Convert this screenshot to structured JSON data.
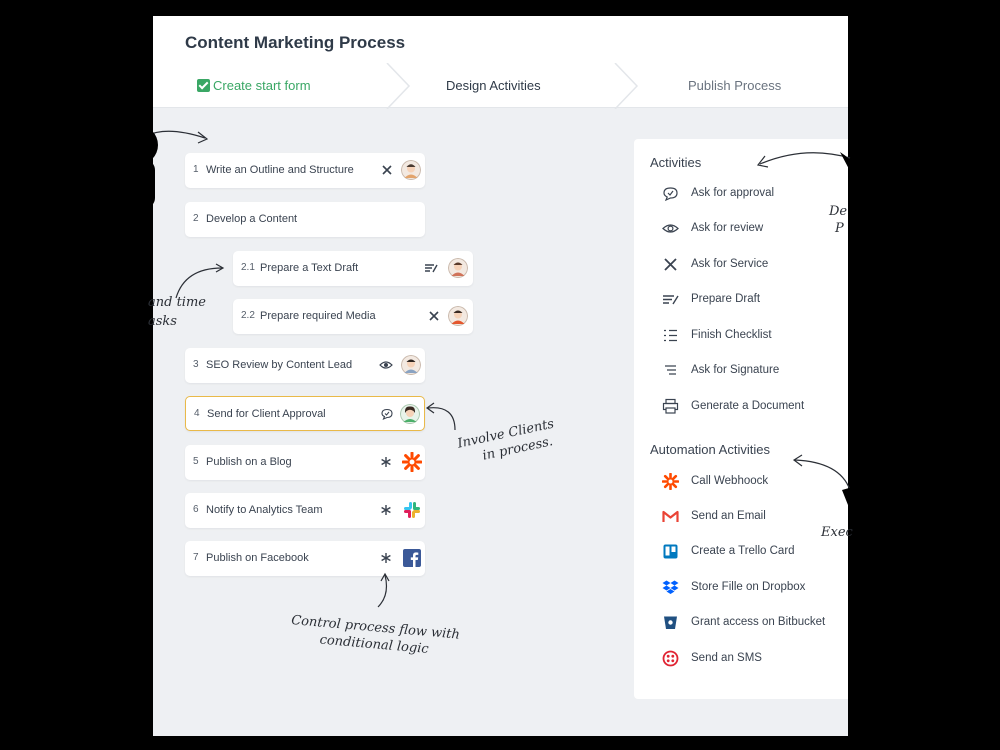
{
  "window": {
    "title": "Content Marketing Process",
    "steps": [
      "Create start form",
      "Design Activities",
      "Publish Process"
    ]
  },
  "tasks": [
    {
      "num": "1",
      "label": "Write an Outline and Structure",
      "icon": "service-icon",
      "avatar": true
    },
    {
      "num": "2",
      "label": "Develop a Content",
      "icon": "",
      "avatar": false
    },
    {
      "num": "2.1",
      "label": "Prepare a Text Draft",
      "icon": "draft-icon",
      "avatar": true
    },
    {
      "num": "2.2",
      "label": "Prepare required Media",
      "icon": "service-icon",
      "avatar": true
    },
    {
      "num": "3",
      "label": "SEO Review by Content Lead",
      "icon": "eye-icon",
      "avatar": true
    },
    {
      "num": "4",
      "label": "Send for Client Approval",
      "icon": "approval-icon",
      "avatar": true
    },
    {
      "num": "5",
      "label": "Publish on a Blog",
      "icon": "asterisk-icon",
      "app": "zapier-logo"
    },
    {
      "num": "6",
      "label": "Notify to Analytics Team",
      "icon": "asterisk-icon",
      "app": "slack-logo"
    },
    {
      "num": "7",
      "label": "Publish on Facebook",
      "icon": "asterisk-icon",
      "app": "facebook-logo"
    }
  ],
  "activities": {
    "heading": "Activities",
    "items": [
      {
        "label": "Ask for approval",
        "icon": "approval-icon"
      },
      {
        "label": "Ask for review",
        "icon": "eye-icon"
      },
      {
        "label": "Ask for Service",
        "icon": "service-icon"
      },
      {
        "label": "Prepare Draft",
        "icon": "draft-icon"
      },
      {
        "label": "Finish Checklist",
        "icon": "checklist-icon"
      },
      {
        "label": "Ask for Signature",
        "icon": "signature-icon"
      },
      {
        "label": "Generate a Document",
        "icon": "printer-icon"
      }
    ]
  },
  "automation": {
    "heading": "Automation Activities",
    "items": [
      {
        "label": "Call Webhoock",
        "icon": "zapier-icon"
      },
      {
        "label": "Send an Email",
        "icon": "gmail-icon"
      },
      {
        "label": "Create a Trello Card",
        "icon": "trello-icon"
      },
      {
        "label": "Store Fille on Dropbox",
        "icon": "dropbox-icon"
      },
      {
        "label": "Grant access on Bitbucket",
        "icon": "bitbucket-icon"
      },
      {
        "label": "Send an SMS",
        "icon": "twilio-icon"
      }
    ]
  },
  "annotations": {
    "deadline": "and time",
    "subtasks": "asks",
    "clients_line1": "Involve Clients",
    "clients_line2": "in process.",
    "flow_line1": "Control process flow with",
    "flow_line2": "conditional logic",
    "design_line1": "De",
    "design_line2": "P",
    "execute": "Exec"
  },
  "colors": {
    "accent_green": "#3aa765",
    "active_border": "#e9b949",
    "panel_bg": "#eef0f3"
  }
}
